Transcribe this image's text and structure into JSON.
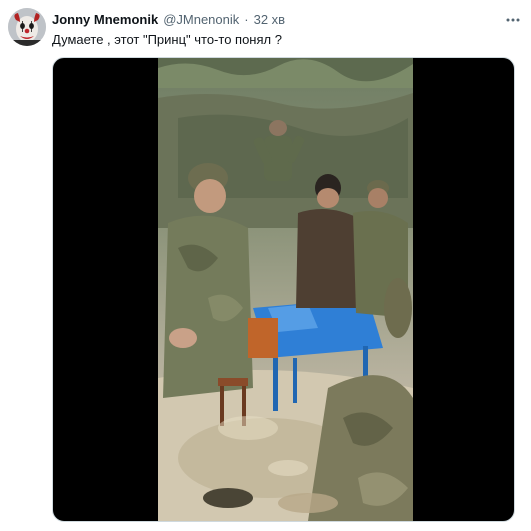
{
  "tweet": {
    "author": {
      "display_name": "Jonny Mnemonik",
      "handle": "@JMnenonik",
      "avatar": "clown-face-avatar"
    },
    "separator": "·",
    "timestamp": "32 хв",
    "text": "Думаете , этот \"Принц\" что-то понял ?",
    "more_icon": "ellipsis-icon",
    "media": {
      "type": "video",
      "description_icon": "video-thumbnail"
    }
  },
  "colors": {
    "text_primary": "#0f1419",
    "text_secondary": "#536471",
    "media_background": "#000000",
    "table_blue": "#2f7fd6"
  }
}
